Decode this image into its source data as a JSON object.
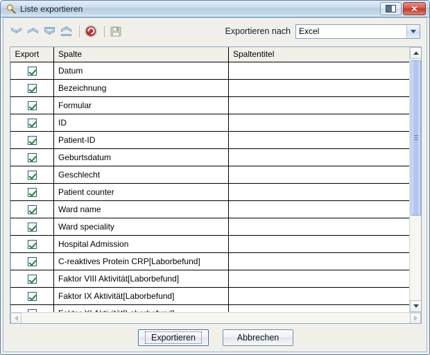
{
  "window": {
    "title": "Liste exportieren",
    "title_icon": "magnifier-icon",
    "restore_button_label": "",
    "close_button_label": "✕"
  },
  "toolbar": {
    "icons": [
      {
        "name": "move-up-icon",
        "label": "Nach oben"
      },
      {
        "name": "move-down-icon",
        "label": "Nach unten"
      },
      {
        "name": "move-to-top-icon",
        "label": "Ganz nach oben"
      },
      {
        "name": "move-to-bottom-icon",
        "label": "Ganz nach unten"
      },
      {
        "name": "reset-icon",
        "label": "Zurücksetzen"
      },
      {
        "name": "save-icon",
        "label": "Speichern"
      }
    ],
    "export_to_label": "Exportieren nach",
    "export_format": "Excel",
    "export_format_options": [
      "Excel"
    ]
  },
  "grid": {
    "columns": [
      "Export",
      "Spalte",
      "Spaltentitel"
    ],
    "rows": [
      {
        "export": true,
        "spalte": "Datum",
        "spaltentitel": ""
      },
      {
        "export": true,
        "spalte": "Bezeichnung",
        "spaltentitel": ""
      },
      {
        "export": true,
        "spalte": "Formular",
        "spaltentitel": ""
      },
      {
        "export": true,
        "spalte": "ID",
        "spaltentitel": ""
      },
      {
        "export": true,
        "spalte": "Patient-ID",
        "spaltentitel": ""
      },
      {
        "export": true,
        "spalte": "Geburtsdatum",
        "spaltentitel": ""
      },
      {
        "export": true,
        "spalte": "Geschlecht",
        "spaltentitel": ""
      },
      {
        "export": true,
        "spalte": "Patient counter",
        "spaltentitel": ""
      },
      {
        "export": true,
        "spalte": "Ward name",
        "spaltentitel": ""
      },
      {
        "export": true,
        "spalte": "Ward speciality",
        "spaltentitel": ""
      },
      {
        "export": true,
        "spalte": "Hospital Admission",
        "spaltentitel": ""
      },
      {
        "export": true,
        "spalte": "C-reaktives Protein CRP[Laborbefund]",
        "spaltentitel": ""
      },
      {
        "export": true,
        "spalte": "Faktor VIII Aktivität[Laborbefund]",
        "spaltentitel": ""
      },
      {
        "export": true,
        "spalte": "Faktor IX Aktivität[Laborbefund]",
        "spaltentitel": ""
      },
      {
        "export": true,
        "spalte": "Faktor XI Aktivität[Laborbefund]",
        "spaltentitel": ""
      }
    ]
  },
  "footer": {
    "export_label": "Exportieren",
    "cancel_label": "Abbrechen"
  },
  "colors": {
    "titlebar": "#c3d7ea",
    "close_button": "#c33a2b",
    "checkmark": "#168a1d",
    "checkbox_border": "#2a5585",
    "scrollbar_thumb": "#aac2f0",
    "dialog_background": "#f0efe9"
  }
}
